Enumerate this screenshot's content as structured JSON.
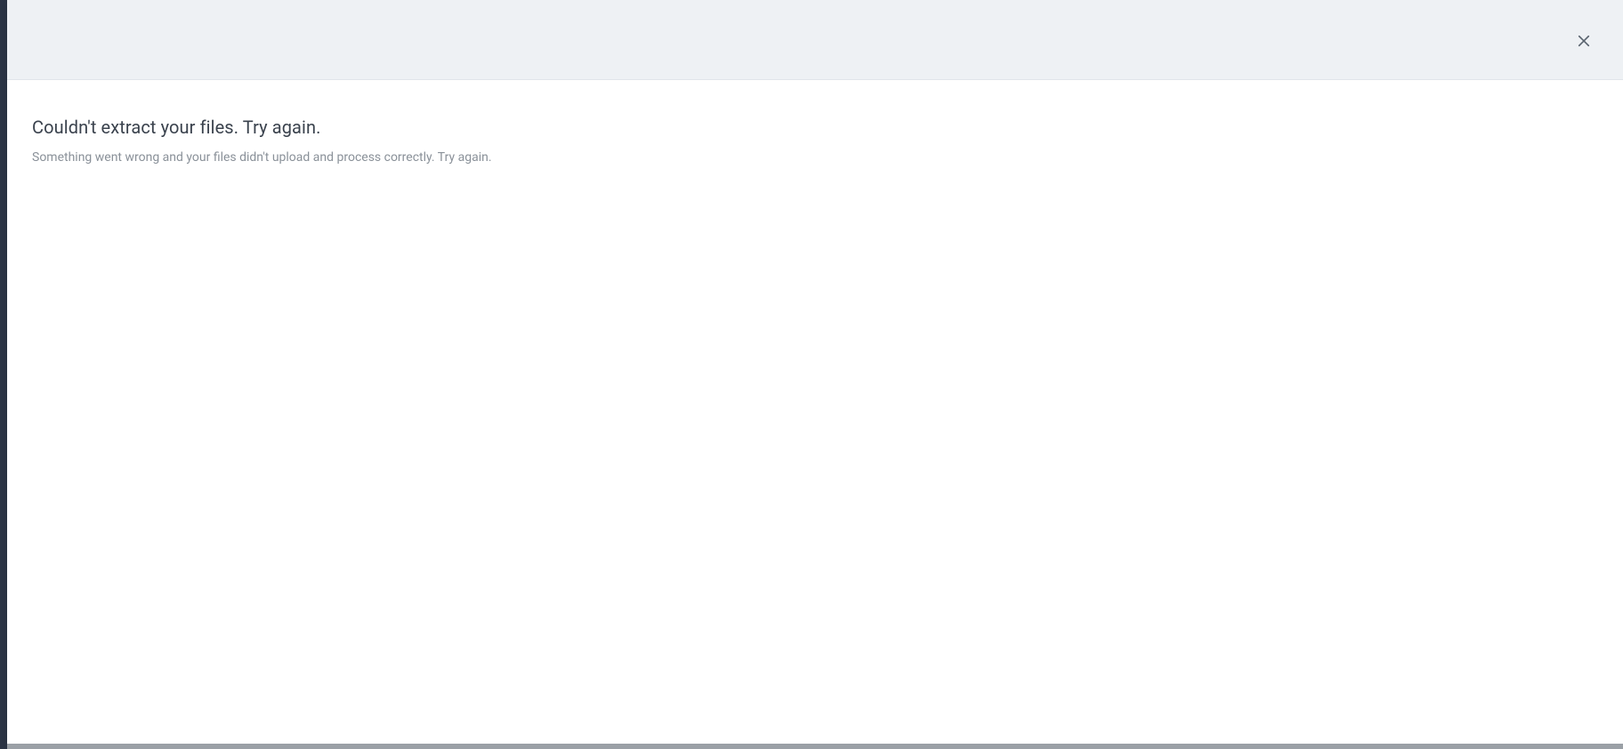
{
  "modal": {
    "close_label": "Close",
    "error": {
      "title": "Couldn't extract your files. Try again.",
      "subtext": "Something went wrong and your files didn't upload and process correctly. Try again."
    }
  }
}
